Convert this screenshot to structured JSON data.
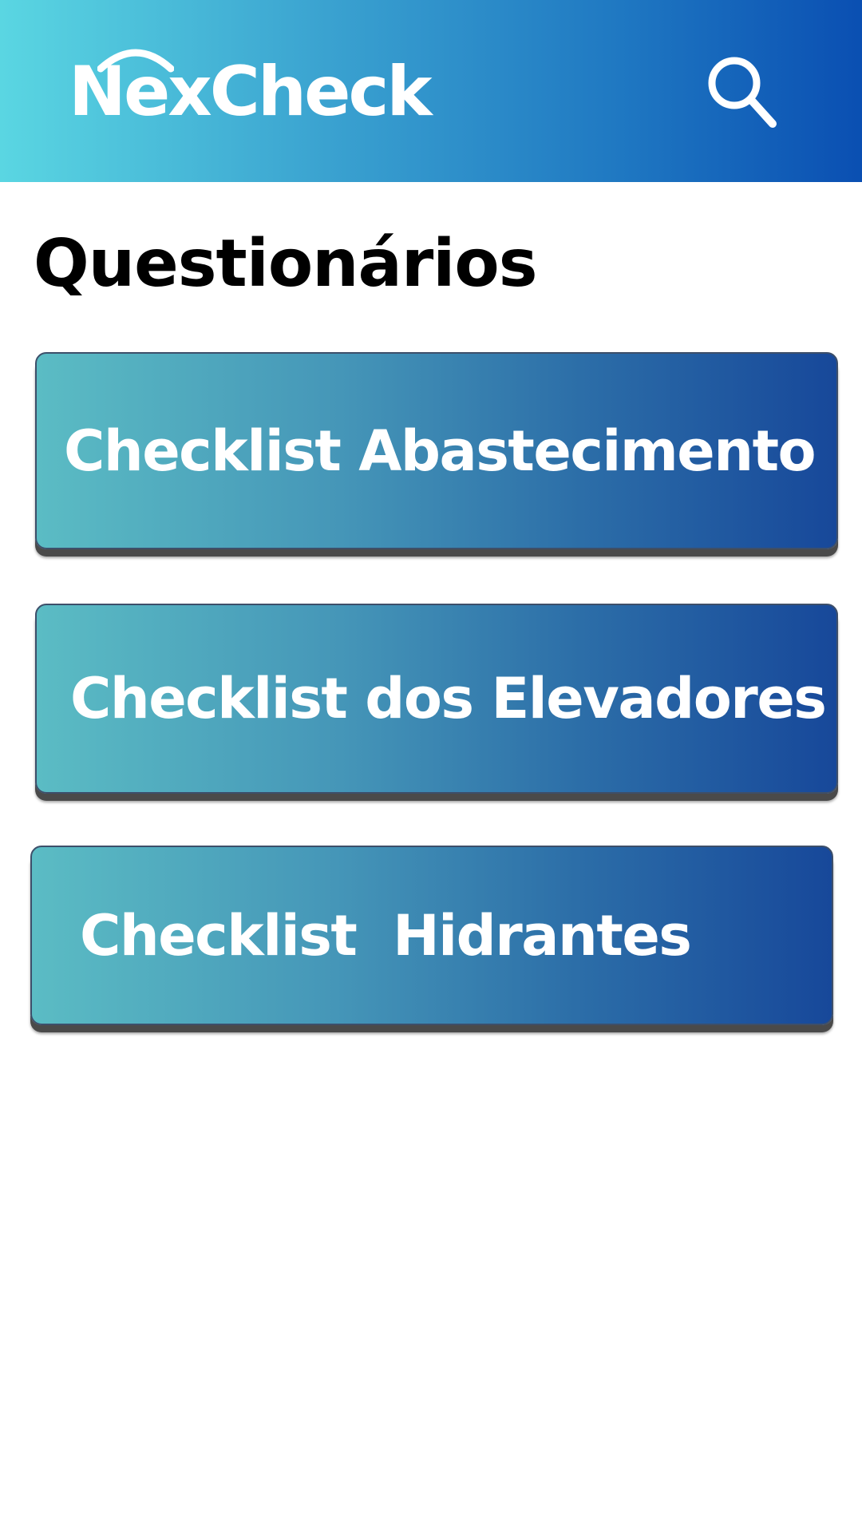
{
  "header": {
    "app_name": "NexCheck",
    "gradient_start": "#5ad6e2",
    "gradient_end": "#0a4fb2",
    "search_icon": "search-icon"
  },
  "main": {
    "title": "Questionários",
    "checklists": [
      {
        "label": "Checklist Abastecimento"
      },
      {
        "label": "Checklist dos Elevadores"
      },
      {
        "label": "Checklist  Hidrantes"
      }
    ],
    "card_gradient_start": "#5bbcc4",
    "card_gradient_end": "#17489a"
  }
}
